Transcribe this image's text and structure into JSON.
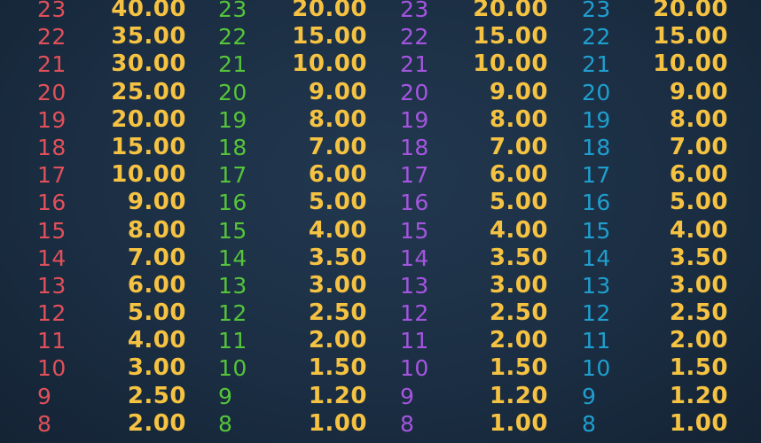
{
  "colors": {
    "payout": "#f5c242",
    "group_colors": [
      "#e0505a",
      "#55c43a",
      "#a455e0",
      "#1f9fcf"
    ]
  },
  "groups": [
    {
      "rows": [
        {
          "count": "23",
          "payout": "40.00"
        },
        {
          "count": "22",
          "payout": "35.00"
        },
        {
          "count": "21",
          "payout": "30.00"
        },
        {
          "count": "20",
          "payout": "25.00"
        },
        {
          "count": "19",
          "payout": "20.00"
        },
        {
          "count": "18",
          "payout": "15.00"
        },
        {
          "count": "17",
          "payout": "10.00"
        },
        {
          "count": "16",
          "payout": "9.00"
        },
        {
          "count": "15",
          "payout": "8.00"
        },
        {
          "count": "14",
          "payout": "7.00"
        },
        {
          "count": "13",
          "payout": "6.00"
        },
        {
          "count": "12",
          "payout": "5.00"
        },
        {
          "count": "11",
          "payout": "4.00"
        },
        {
          "count": "10",
          "payout": "3.00"
        },
        {
          "count": "9",
          "payout": "2.50"
        },
        {
          "count": "8",
          "payout": "2.00"
        }
      ]
    },
    {
      "rows": [
        {
          "count": "23",
          "payout": "20.00"
        },
        {
          "count": "22",
          "payout": "15.00"
        },
        {
          "count": "21",
          "payout": "10.00"
        },
        {
          "count": "20",
          "payout": "9.00"
        },
        {
          "count": "19",
          "payout": "8.00"
        },
        {
          "count": "18",
          "payout": "7.00"
        },
        {
          "count": "17",
          "payout": "6.00"
        },
        {
          "count": "16",
          "payout": "5.00"
        },
        {
          "count": "15",
          "payout": "4.00"
        },
        {
          "count": "14",
          "payout": "3.50"
        },
        {
          "count": "13",
          "payout": "3.00"
        },
        {
          "count": "12",
          "payout": "2.50"
        },
        {
          "count": "11",
          "payout": "2.00"
        },
        {
          "count": "10",
          "payout": "1.50"
        },
        {
          "count": "9",
          "payout": "1.20"
        },
        {
          "count": "8",
          "payout": "1.00"
        }
      ]
    },
    {
      "rows": [
        {
          "count": "23",
          "payout": "20.00"
        },
        {
          "count": "22",
          "payout": "15.00"
        },
        {
          "count": "21",
          "payout": "10.00"
        },
        {
          "count": "20",
          "payout": "9.00"
        },
        {
          "count": "19",
          "payout": "8.00"
        },
        {
          "count": "18",
          "payout": "7.00"
        },
        {
          "count": "17",
          "payout": "6.00"
        },
        {
          "count": "16",
          "payout": "5.00"
        },
        {
          "count": "15",
          "payout": "4.00"
        },
        {
          "count": "14",
          "payout": "3.50"
        },
        {
          "count": "13",
          "payout": "3.00"
        },
        {
          "count": "12",
          "payout": "2.50"
        },
        {
          "count": "11",
          "payout": "2.00"
        },
        {
          "count": "10",
          "payout": "1.50"
        },
        {
          "count": "9",
          "payout": "1.20"
        },
        {
          "count": "8",
          "payout": "1.00"
        }
      ]
    },
    {
      "rows": [
        {
          "count": "23",
          "payout": "20.00"
        },
        {
          "count": "22",
          "payout": "15.00"
        },
        {
          "count": "21",
          "payout": "10.00"
        },
        {
          "count": "20",
          "payout": "9.00"
        },
        {
          "count": "19",
          "payout": "8.00"
        },
        {
          "count": "18",
          "payout": "7.00"
        },
        {
          "count": "17",
          "payout": "6.00"
        },
        {
          "count": "16",
          "payout": "5.00"
        },
        {
          "count": "15",
          "payout": "4.00"
        },
        {
          "count": "14",
          "payout": "3.50"
        },
        {
          "count": "13",
          "payout": "3.00"
        },
        {
          "count": "12",
          "payout": "2.50"
        },
        {
          "count": "11",
          "payout": "2.00"
        },
        {
          "count": "10",
          "payout": "1.50"
        },
        {
          "count": "9",
          "payout": "1.20"
        },
        {
          "count": "8",
          "payout": "1.00"
        }
      ]
    }
  ]
}
